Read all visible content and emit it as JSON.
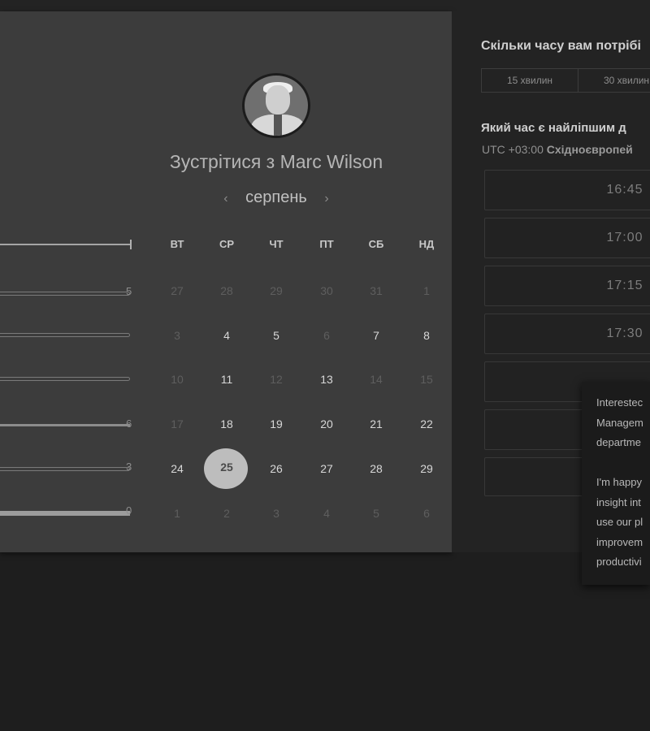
{
  "meeting": {
    "title": "Зустрітися з Marc Wilson",
    "month": "серпень",
    "prev_icon": "‹",
    "next_icon": "›"
  },
  "calendar": {
    "weekdays": [
      "ВТ",
      "СР",
      "ЧТ",
      "ПТ",
      "СБ",
      "НД"
    ],
    "row_tail_numbers": [
      "5",
      "",
      "",
      "6",
      "3",
      "0"
    ],
    "weeks": [
      [
        {
          "d": "27",
          "s": "muted"
        },
        {
          "d": "28",
          "s": "muted"
        },
        {
          "d": "29",
          "s": "muted"
        },
        {
          "d": "30",
          "s": "muted"
        },
        {
          "d": "31",
          "s": "muted"
        },
        {
          "d": "1",
          "s": "muted"
        }
      ],
      [
        {
          "d": "3",
          "s": "muted"
        },
        {
          "d": "4",
          "s": "avail"
        },
        {
          "d": "5",
          "s": "avail"
        },
        {
          "d": "6",
          "s": "muted"
        },
        {
          "d": "7",
          "s": "avail"
        },
        {
          "d": "8",
          "s": "avail"
        }
      ],
      [
        {
          "d": "10",
          "s": "muted"
        },
        {
          "d": "11",
          "s": "avail"
        },
        {
          "d": "12",
          "s": "muted"
        },
        {
          "d": "13",
          "s": "avail"
        },
        {
          "d": "14",
          "s": "muted"
        },
        {
          "d": "15",
          "s": "muted"
        }
      ],
      [
        {
          "d": "17",
          "s": "muted"
        },
        {
          "d": "18",
          "s": "avail"
        },
        {
          "d": "19",
          "s": "avail"
        },
        {
          "d": "20",
          "s": "avail"
        },
        {
          "d": "21",
          "s": "avail"
        },
        {
          "d": "22",
          "s": "avail"
        }
      ],
      [
        {
          "d": "24",
          "s": "avail"
        },
        {
          "d": "25",
          "s": "sel"
        },
        {
          "d": "26",
          "s": "avail"
        },
        {
          "d": "27",
          "s": "avail"
        },
        {
          "d": "28",
          "s": "avail"
        },
        {
          "d": "29",
          "s": "avail"
        }
      ],
      [
        {
          "d": "1",
          "s": "muted"
        },
        {
          "d": "2",
          "s": "muted"
        },
        {
          "d": "3",
          "s": "muted"
        },
        {
          "d": "4",
          "s": "muted"
        },
        {
          "d": "5",
          "s": "muted"
        },
        {
          "d": "6",
          "s": "muted"
        }
      ]
    ],
    "selected_day": "25"
  },
  "duration": {
    "question": "Скільки часу вам потрібі",
    "options": [
      "15 хвилин",
      "30 хвилин"
    ]
  },
  "time": {
    "question": "Який час є найліпшим д",
    "tz_offset": "UTC +03:00",
    "tz_name": "Східноєвропей",
    "slots": [
      "16:45",
      "17:00",
      "17:15",
      "17:30",
      "",
      "",
      ""
    ]
  },
  "tooltip": {
    "lines": [
      "Interestec",
      "Managem",
      "departme",
      "",
      "I'm happy",
      "insight int",
      "use our pl",
      "improvem",
      "productivi"
    ]
  },
  "colors": {
    "panel": "#3c3c3c",
    "right_panel": "#232323",
    "selected_day_bg": "#bdbdbd"
  }
}
